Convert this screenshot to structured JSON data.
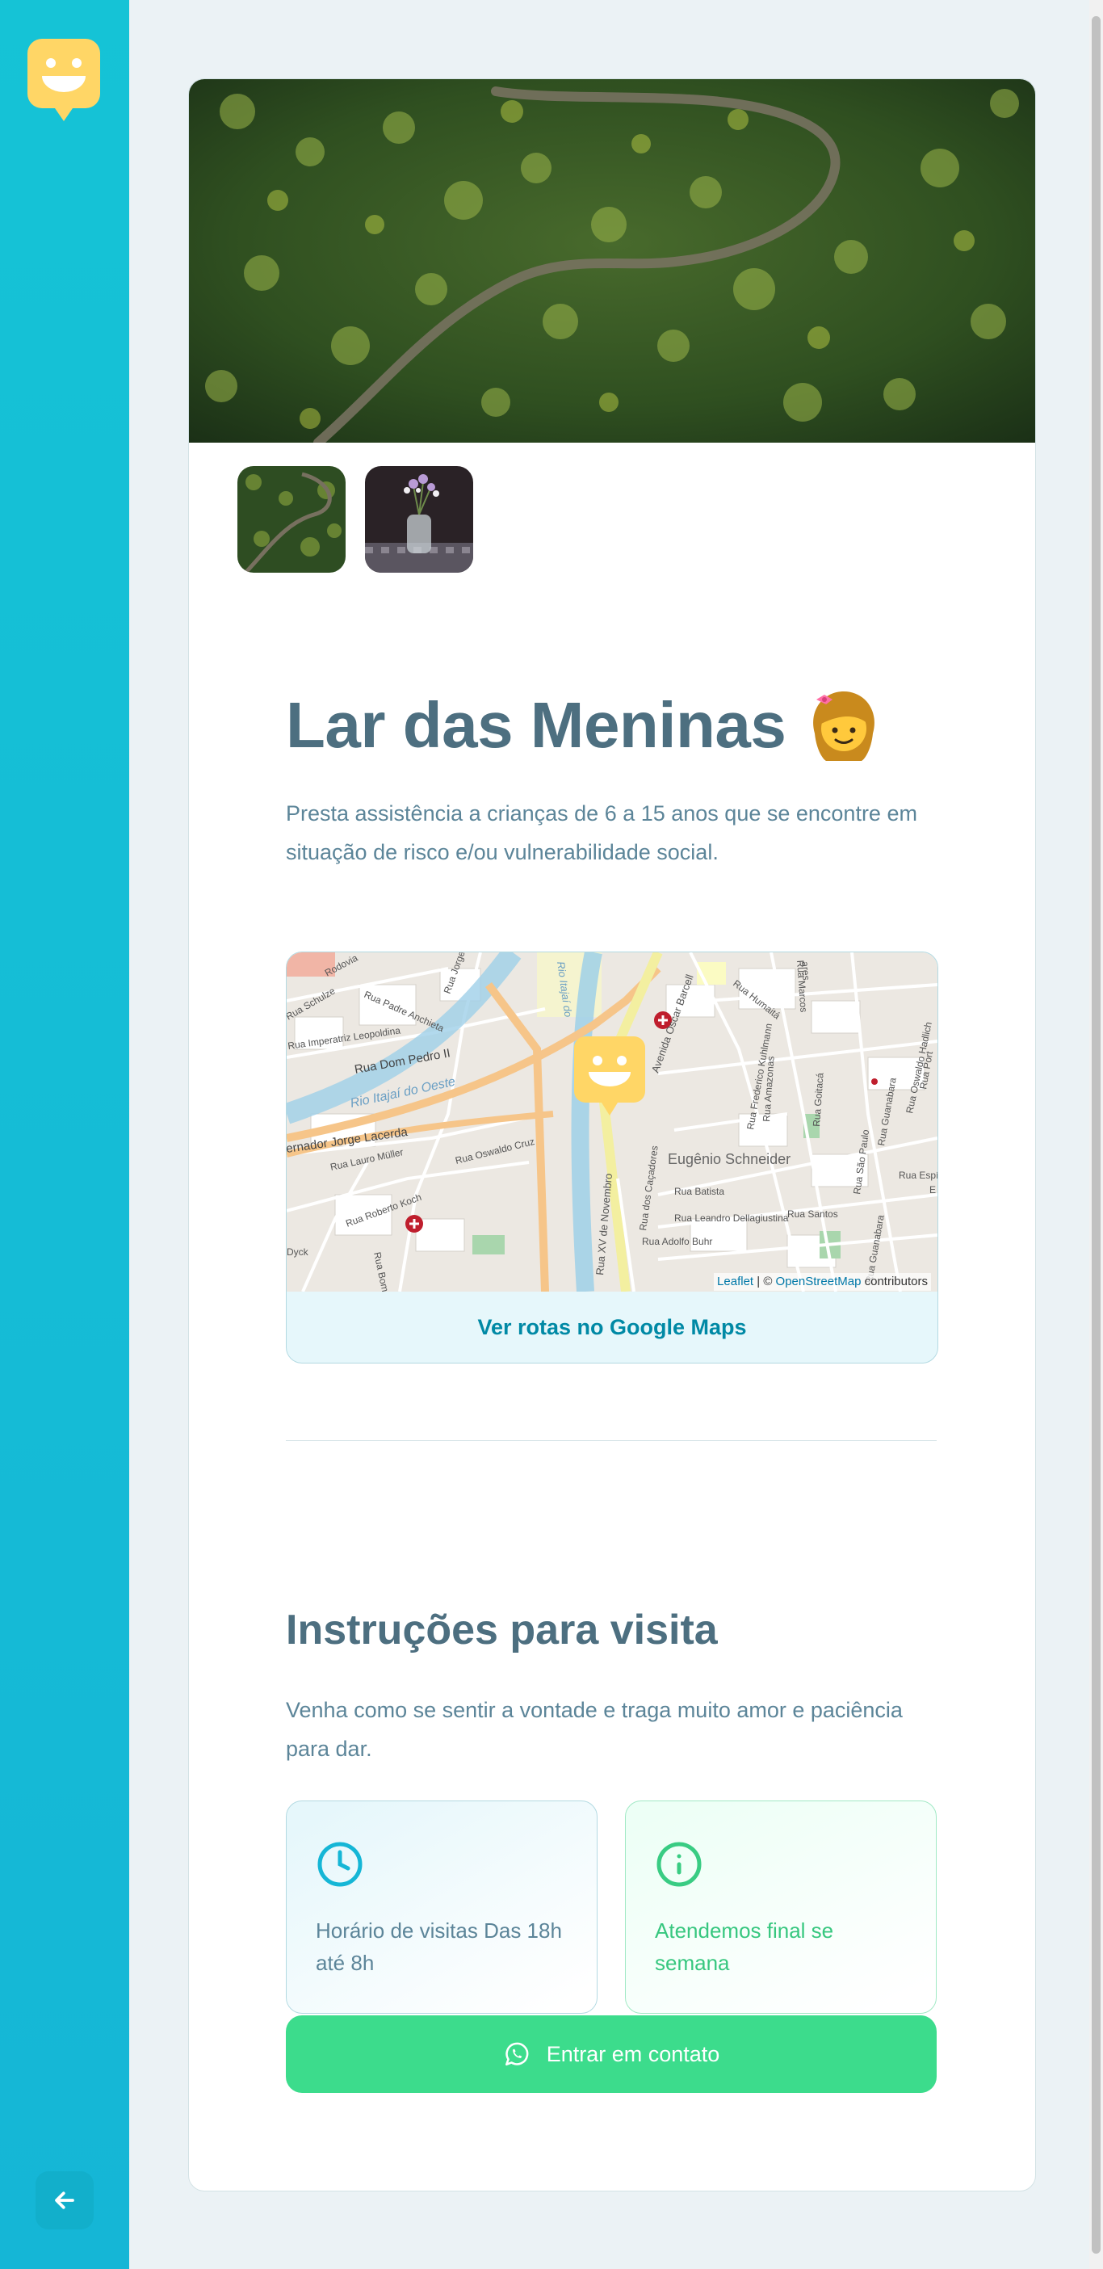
{
  "colors": {
    "sidebar": "#15c3d6",
    "title": "#4d6f80",
    "text": "#5c8599",
    "link": "#0089a5",
    "whatsapp_button": "#3cdc8c",
    "weekend_text": "#37c77f",
    "logo_yellow": "#ffd666"
  },
  "sidebar": {
    "logo_icon": "smiley-map-marker-icon",
    "back_icon": "arrow-left-icon"
  },
  "orphanage": {
    "name": "Lar das Meninas",
    "emoji": "👧",
    "about": "Presta assistência a crianças de 6 a 15 anos que se encontre em situação de risco e/ou vulnerabilidade social.",
    "images": [
      "forest-road-aerial",
      "flowers-in-glass-jar"
    ]
  },
  "map": {
    "attribution_leaflet": "Leaflet",
    "attribution_sep": " | © ",
    "attribution_osm": "OpenStreetMap",
    "attribution_contrib": " contributors",
    "directions_label": "Ver rotas no Google Maps",
    "labels": {
      "rodovia": "Rodovia",
      "padre": "Rua Padre Anchieta",
      "jorge": "Rua Jorge S",
      "imperatriz": "Rua Imperatriz Leopoldina",
      "dom_pedro": "Rua Dom Pedro II",
      "rio_itajai": "Rio Itajaí do Oeste",
      "rio_itajai_v": "Rio Itajaí do",
      "governador": "ernador Jorge Lacerda",
      "schulze": "Rua Schulze",
      "lauro": "Rua Lauro Müller",
      "oswaldo_cruz": "Rua Oswaldo Cruz",
      "roberto_koch": "Rua Roberto Koch",
      "dyck": "Dyck",
      "bom": "Rua Bom R",
      "xv": "Rua XV de Novembro",
      "oscar": "Avenida Oscar Barcell",
      "cacadores": "Rua dos Caçadores",
      "batista": "Rua Batista",
      "leandro": "Rua Leandro Dellagiustina",
      "adolfo": "Rua Adolfo Buhr",
      "santos": "Rua Santos",
      "eugenio": "Eugênio Schneider",
      "humaita": "Rua Humaitá",
      "amazonas": "Rua Amazonas",
      "goitaca": "Rua Goitacá",
      "kuhlmann": "Rua Frederico Kuhlmann",
      "sao_paulo": "Rua São Paulo",
      "guanabara": "Rua Guanabara",
      "guanabara2": "Rua Guanabara",
      "marcos": "Rua Marcos",
      "espirito": "Rua Espírito Sant",
      "oswaldo_hadlich": "Rua Oswaldo Hadlich",
      "ares": "ares",
      "port": "Rua Port",
      "e": "E"
    }
  },
  "visit": {
    "heading": "Instruções para visita",
    "instructions": "Venha como se sentir a vontade e traga muito amor e paciência para dar.",
    "hours": {
      "icon": "clock-icon",
      "text": "Horário de visitas Das 18h até 8h"
    },
    "weekends": {
      "icon": "info-icon",
      "text": "Atendemos final se semana"
    },
    "contact_icon": "whatsapp-icon",
    "contact_label": "Entrar em contato"
  }
}
